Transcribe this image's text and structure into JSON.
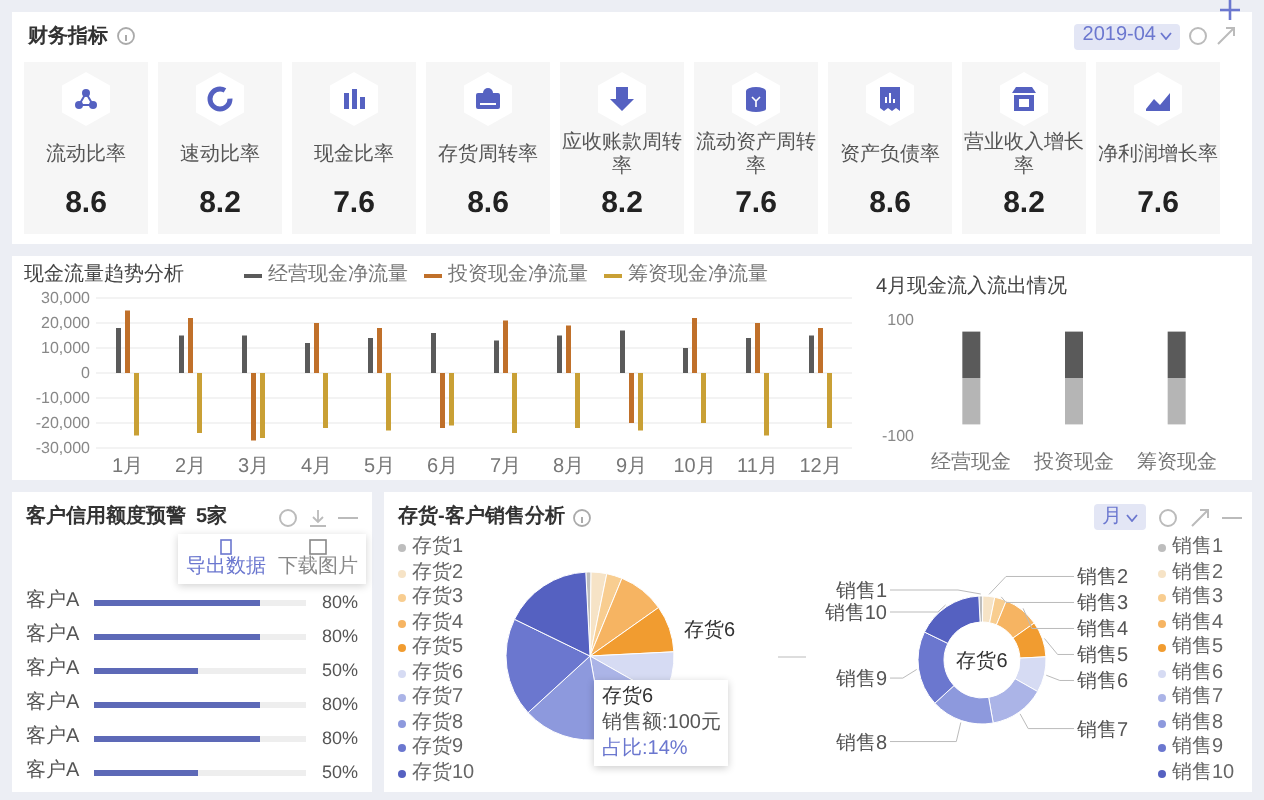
{
  "indicators": {
    "title": "财务指标",
    "period": "2019-04",
    "cards": [
      {
        "label": "流动比率",
        "value": "8.6"
      },
      {
        "label": "速动比率",
        "value": "8.2"
      },
      {
        "label": "现金比率",
        "value": "7.6"
      },
      {
        "label": "存货周转率",
        "value": "8.6"
      },
      {
        "label": "应收账款周转率",
        "value": "8.2"
      },
      {
        "label": "流动资产周转率",
        "value": "7.6"
      },
      {
        "label": "资产负债率",
        "value": "8.6"
      },
      {
        "label": "营业收入增长率",
        "value": "8.2"
      },
      {
        "label": "净利润增长率",
        "value": "7.6"
      }
    ]
  },
  "cashflow": {
    "title": "现金流量趋势分析",
    "chart_data": {
      "type": "bar",
      "grid": true,
      "categories": [
        "1月",
        "2月",
        "3月",
        "4月",
        "5月",
        "6月",
        "7月",
        "8月",
        "9月",
        "10月",
        "11月",
        "12月"
      ],
      "series": [
        {
          "name": "经营现金净流量",
          "color": "#5a5a5a",
          "values": [
            18000,
            15000,
            15000,
            12000,
            14000,
            16000,
            13000,
            15000,
            17000,
            10000,
            14000,
            15000
          ]
        },
        {
          "name": "投资现金净流量",
          "color": "#c0702a",
          "values": [
            25000,
            22000,
            -27000,
            20000,
            18000,
            -22000,
            21000,
            19000,
            -20000,
            22000,
            20000,
            18000
          ]
        },
        {
          "name": "筹资现金净流量",
          "color": "#c9a035",
          "values": [
            -25000,
            -24000,
            -26000,
            -22000,
            -23000,
            -21000,
            -24000,
            -22000,
            -23000,
            -20000,
            -25000,
            -22000
          ]
        }
      ],
      "ylim": [
        -30000,
        30000
      ],
      "yticks": [
        {
          "value": 30000,
          "label": "30,000"
        },
        {
          "value": 20000,
          "label": "20,000"
        },
        {
          "value": 10000,
          "label": "10,000"
        },
        {
          "value": 0,
          "label": "0"
        },
        {
          "value": -10000,
          "label": "-10,000"
        },
        {
          "value": -20000,
          "label": "-20,000"
        },
        {
          "value": -30000,
          "label": "-30,000"
        }
      ]
    }
  },
  "monthly_flow": {
    "title": "4月现金流入流出情况",
    "chart_data": {
      "type": "bar",
      "categories": [
        "经营现金",
        "投资现金",
        "筹资现金"
      ],
      "series": [
        {
          "color": "#5a5a5a",
          "values": [
            80,
            80,
            80
          ]
        },
        {
          "color": "#b5b5b5",
          "values": [
            -80,
            -80,
            -80
          ]
        }
      ],
      "stacked": true,
      "ylim": [
        -100,
        100
      ],
      "yticks": [
        {
          "value": 100,
          "label": "100"
        },
        {
          "value": -100,
          "label": "-100"
        }
      ]
    }
  },
  "credit": {
    "title": "客户信用额度预警",
    "count": "5家",
    "menu": [
      {
        "label": "导出数据"
      },
      {
        "label": "下载图片"
      }
    ],
    "rows": [
      {
        "name": "客户A",
        "level": 0.78,
        "reading": "80%"
      },
      {
        "name": "客户A",
        "level": 0.78,
        "reading": "80%"
      },
      {
        "name": "客户A",
        "level": 0.49,
        "reading": "50%"
      },
      {
        "name": "客户A",
        "level": 0.78,
        "reading": "80%"
      },
      {
        "name": "客户A",
        "level": 0.78,
        "reading": "80%"
      },
      {
        "name": "客户A",
        "level": 0.49,
        "reading": "50%"
      }
    ]
  },
  "sales": {
    "title": "存货-客户销售分析",
    "period": "月",
    "pie_legend": [
      {
        "label": "存货1",
        "color": "#bdbdbd"
      },
      {
        "label": "存货2",
        "color": "#f6e3c6"
      },
      {
        "label": "存货3",
        "color": "#f8cd90"
      },
      {
        "label": "存货4",
        "color": "#f6b462"
      },
      {
        "label": "存货5",
        "color": "#f19c30"
      },
      {
        "label": "存货6",
        "color": "#d6dbf3"
      },
      {
        "label": "存货7",
        "color": "#abb4e7"
      },
      {
        "label": "存货8",
        "color": "#8d99dd"
      },
      {
        "label": "存货9",
        "color": "#6b77cf"
      },
      {
        "label": "存货10",
        "color": "#5561c1"
      }
    ],
    "pie_label": "存货6",
    "tooltip": {
      "title": "存货6",
      "lines": [
        "销售额:100元",
        "占比:14%"
      ]
    },
    "donut_center": "存货6",
    "donut_labels": {
      "left": [
        "销售1",
        "销售10",
        "销售9",
        "销售8"
      ],
      "right": [
        "销售2",
        "销售3",
        "销售4",
        "销售5",
        "销售6",
        "销售7"
      ]
    },
    "donut_legend": [
      {
        "label": "销售1",
        "color": "#bdbdbd"
      },
      {
        "label": "销售2",
        "color": "#f6e3c6"
      },
      {
        "label": "销售3",
        "color": "#f8cd90"
      },
      {
        "label": "销售4",
        "color": "#f6b462"
      },
      {
        "label": "销售5",
        "color": "#f19c30"
      },
      {
        "label": "销售6",
        "color": "#d6dbf3"
      },
      {
        "label": "销售7",
        "color": "#abb4e7"
      },
      {
        "label": "销售8",
        "color": "#8d99dd"
      },
      {
        "label": "销售9",
        "color": "#6b77cf"
      },
      {
        "label": "销售10",
        "color": "#5561c1"
      }
    ]
  }
}
